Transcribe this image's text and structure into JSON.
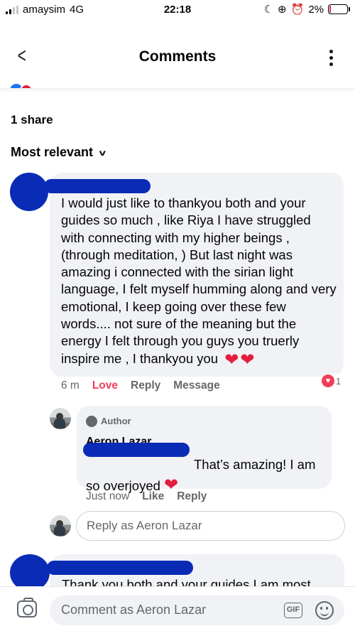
{
  "status_bar": {
    "carrier": "amaysim",
    "network": "4G",
    "time": "22:18",
    "battery": "2%",
    "battery_level": 0.02,
    "signal_bars_active": 2,
    "signal_bars_total": 4
  },
  "header": {
    "title": "Comments",
    "back_icon": "chevron-left-icon",
    "menu_icon": "more-vertical-icon"
  },
  "post_meta": {
    "shares": "1 share",
    "sort_label": "Most relevant"
  },
  "comments": [
    {
      "text": "I would just like to thankyou both  and your guides so much , like Riya I have struggled with connecting with my higher beings , (through meditation, ) But last night  was amazing i connected with the sirian light language,  I felt myself humming along and very emotional,  I keep going over these few words.... not sure of the  meaning but the energy I felt through you guys you truerly inspire me , I thankyou you",
      "emoji": "❤️❤️",
      "time": "6 m",
      "reaction_label": "Love",
      "reply_label": "Reply",
      "message_label": "Message",
      "reaction_count": "1"
    },
    {
      "text": "Thank you both and your guides I am most"
    }
  ],
  "reply": {
    "author_badge": "Author",
    "name": "Aeron Lazar",
    "text_part1": "That’s amazing! I am",
    "text_part2": "so overjoyed",
    "emoji": "❤️",
    "time": "Just now",
    "like_label": "Like",
    "reply_label": "Reply"
  },
  "reply_input": {
    "placeholder": "Reply as Aeron Lazar"
  },
  "comment_bar": {
    "placeholder": "Comment as Aeron Lazar",
    "gif_label": "GIF"
  },
  "colors": {
    "love": "#f33e58",
    "bubble": "#f0f2f5",
    "redaction": "#0a2bb6",
    "muted_text": "#65676b"
  }
}
